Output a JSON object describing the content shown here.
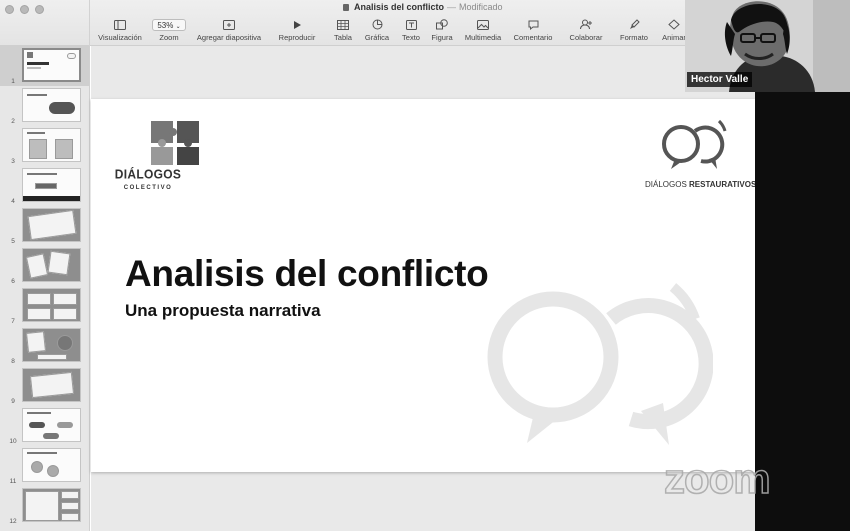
{
  "window": {
    "title": "Analisis del conflicto",
    "separator": "—",
    "status": "Modificado"
  },
  "toolbar": {
    "view": "Visualización",
    "zoom_value": "53%",
    "zoom": "Zoom",
    "add_slide": "Agregar diapositiva",
    "play": "Reproducir",
    "table": "Tabla",
    "chart": "Gráfica",
    "text": "Texto",
    "shape": "Figura",
    "media": "Multimedia",
    "comment": "Comentario",
    "collaborate": "Colaborar",
    "format": "Formato",
    "animate": "Animar"
  },
  "navigator": {
    "slides": [
      "1",
      "2",
      "3",
      "4",
      "5",
      "6",
      "7",
      "8",
      "9",
      "10",
      "11",
      "12"
    ],
    "selected": "1"
  },
  "slide": {
    "title": "Analisis del conflicto",
    "subtitle": "Una propuesta narrativa",
    "logo_left_name": "DIÁLOGOS",
    "logo_left_sub": "COLECTIVO",
    "logo_right_name_a": "DIÁLOGOS",
    "logo_right_name_b": "RESTAURATIVOS"
  },
  "video": {
    "participant_name": "Hector Valle"
  },
  "overlay": {
    "zoom_watermark": "zoom"
  }
}
